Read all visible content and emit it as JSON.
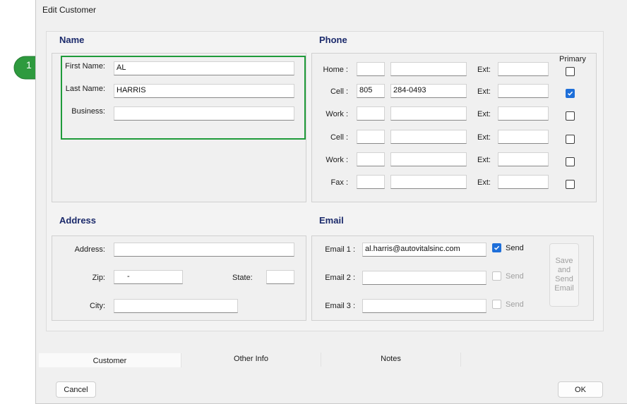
{
  "window": {
    "title": "Edit Customer"
  },
  "callout": {
    "number": "1"
  },
  "name": {
    "section_title": "Name",
    "first_name_label": "First Name:",
    "first_name_value": "AL",
    "last_name_label": "Last Name:",
    "last_name_value": "HARRIS",
    "business_label": "Business:",
    "business_value": ""
  },
  "phone": {
    "section_title": "Phone",
    "primary_header": "Primary",
    "ext_label": "Ext:",
    "rows": [
      {
        "label": "Home :",
        "area": "",
        "number": "",
        "ext": "",
        "primary": false
      },
      {
        "label": "Cell :",
        "area": "805",
        "number": "284-0493",
        "ext": "",
        "primary": true
      },
      {
        "label": "Work :",
        "area": "",
        "number": "",
        "ext": "",
        "primary": false
      },
      {
        "label": "Cell :",
        "area": "",
        "number": "",
        "ext": "",
        "primary": false
      },
      {
        "label": "Work :",
        "area": "",
        "number": "",
        "ext": "",
        "primary": false
      },
      {
        "label": "Fax :",
        "area": "",
        "number": "",
        "ext": "",
        "primary": false
      }
    ]
  },
  "address": {
    "section_title": "Address",
    "address_label": "Address:",
    "address_value": "",
    "zip_label": "Zip:",
    "zip_value": "-",
    "state_label": "State:",
    "state_value": "",
    "city_label": "City:",
    "city_value": ""
  },
  "email": {
    "section_title": "Email",
    "send_label": "Send",
    "rows": [
      {
        "label": "Email 1 :",
        "value": "al.harris@autovitalsinc.com",
        "send": true,
        "enabled": true
      },
      {
        "label": "Email 2 :",
        "value": "",
        "send": false,
        "enabled": false
      },
      {
        "label": "Email 3 :",
        "value": "",
        "send": false,
        "enabled": false
      }
    ],
    "save_button_lines": [
      "Save",
      "and",
      "Send",
      "Email"
    ]
  },
  "tabs": [
    {
      "label": "Customer",
      "active": true
    },
    {
      "label": "Other Info",
      "active": false
    },
    {
      "label": "Notes",
      "active": false
    }
  ],
  "buttons": {
    "cancel": "Cancel",
    "ok": "OK"
  },
  "colors": {
    "section_title": "#1b2a6b",
    "highlight": "#1f9b3a",
    "checkbox_checked": "#1e6fd9"
  }
}
